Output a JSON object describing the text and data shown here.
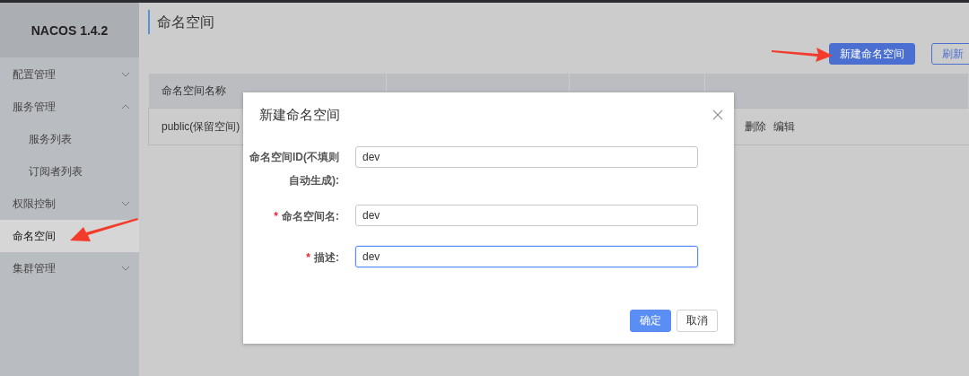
{
  "sidebar": {
    "title": "NACOS 1.4.2",
    "items": [
      {
        "label": "配置管理",
        "selected": false,
        "expanded": false
      },
      {
        "label": "服务管理",
        "selected": false,
        "expanded": true,
        "children": [
          {
            "label": "服务列表",
            "selected": false
          },
          {
            "label": "订阅者列表",
            "selected": false
          }
        ]
      },
      {
        "label": "权限控制",
        "selected": false,
        "expanded": false
      },
      {
        "label": "命名空间",
        "selected": true
      },
      {
        "label": "集群管理",
        "selected": false,
        "expanded": false
      }
    ]
  },
  "page": {
    "title": "命名空间",
    "buttons": [
      {
        "label": "新建命名空间",
        "kind": "primary"
      },
      {
        "label": "刷新",
        "kind": "outline"
      }
    ]
  },
  "table": {
    "columns": [
      "命名空间名称"
    ],
    "rows": [
      {
        "name": "public(保留空间)",
        "actions": [
          "删除",
          "编辑"
        ]
      }
    ]
  },
  "dialog": {
    "title": "新建命名空间",
    "fields": [
      {
        "label": "命名空间ID(不填则自动生成):",
        "value": "dev",
        "focused": false
      },
      {
        "required_mark": "*",
        "label": "命名空间名:",
        "value": "dev",
        "focused": false
      },
      {
        "required_mark": "*",
        "label": "描述:",
        "value": "dev",
        "focused": true
      }
    ],
    "buttons": [
      {
        "label": "确定",
        "kind": "primary"
      },
      {
        "label": "取消",
        "kind": "plain"
      }
    ]
  }
}
